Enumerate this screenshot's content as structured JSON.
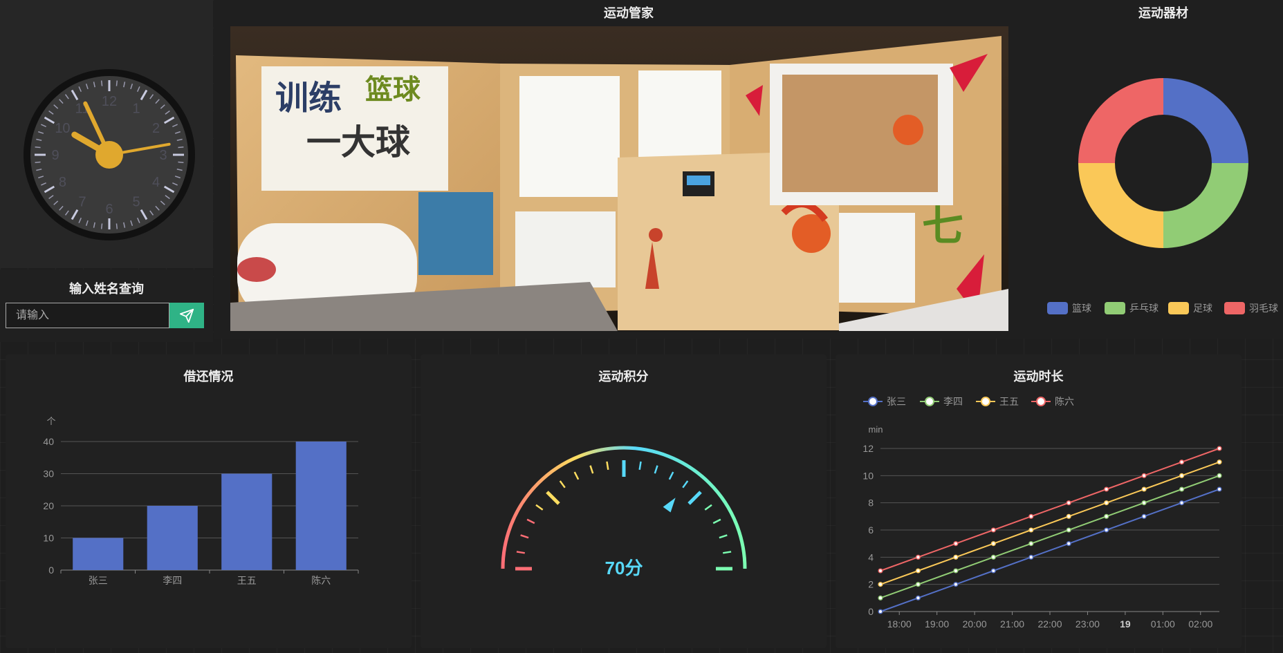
{
  "clock": {
    "hour_numbers": [
      "12",
      "1",
      "2",
      "3",
      "4",
      "5",
      "6",
      "7",
      "8",
      "9",
      "10",
      "11"
    ]
  },
  "query": {
    "title": "输入姓名查询",
    "placeholder": "请输入"
  },
  "photo_panel": {
    "title": "运动管家"
  },
  "equipment": {
    "title": "运动器材",
    "items": [
      {
        "name": "篮球",
        "value": 25,
        "color": "#5470c6"
      },
      {
        "name": "乒乓球",
        "value": 25,
        "color": "#91cc75"
      },
      {
        "name": "足球",
        "value": 25,
        "color": "#fac858"
      },
      {
        "name": "羽毛球",
        "value": 25,
        "color": "#ee6666"
      }
    ]
  },
  "borrow": {
    "title": "借还情况",
    "chart_data": {
      "type": "bar",
      "categories": [
        "张三",
        "李四",
        "王五",
        "陈六"
      ],
      "values": [
        10,
        20,
        30,
        40
      ],
      "ylabel": "个",
      "ylim": [
        0,
        40
      ],
      "yticks": [
        "0",
        "10",
        "20",
        "30",
        "40"
      ],
      "color": "#5470c6"
    }
  },
  "score": {
    "title": "运动积分",
    "value": 70,
    "label": "70分",
    "max": 100
  },
  "duration": {
    "title": "运动时长",
    "chart_data": {
      "type": "line",
      "ylabel": "min",
      "ylim": [
        0,
        12
      ],
      "yticks": [
        "0",
        "2",
        "4",
        "6",
        "8",
        "10",
        "12"
      ],
      "x": [
        "17:30",
        "18:30",
        "19:30",
        "20:30",
        "21:30",
        "22:30",
        "23:30",
        "00:30",
        "01:30",
        "02:30"
      ],
      "xticks": [
        "18:00",
        "19:00",
        "20:00",
        "21:00",
        "22:00",
        "23:00",
        "19",
        "01:00",
        "02:00"
      ],
      "series": [
        {
          "name": "张三",
          "color": "#5470c6",
          "values": [
            0,
            1,
            2,
            3,
            4,
            5,
            6,
            7,
            8,
            9
          ]
        },
        {
          "name": "李四",
          "color": "#91cc75",
          "values": [
            1,
            2,
            3,
            4,
            5,
            6,
            7,
            8,
            9,
            10
          ]
        },
        {
          "name": "王五",
          "color": "#fac858",
          "values": [
            2,
            3,
            4,
            5,
            6,
            7,
            8,
            9,
            10,
            11
          ]
        },
        {
          "name": "陈六",
          "color": "#ee6666",
          "values": [
            3,
            4,
            5,
            6,
            7,
            8,
            9,
            10,
            11,
            12
          ]
        }
      ]
    }
  }
}
